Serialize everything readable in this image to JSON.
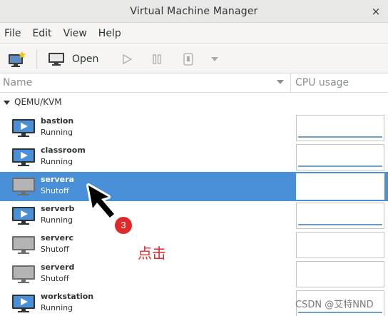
{
  "window": {
    "title": "Virtual Machine Manager",
    "close_glyph": "×"
  },
  "menu": [
    "File",
    "Edit",
    "View",
    "Help"
  ],
  "toolbar": {
    "new_vm_icon": "new-vm-icon",
    "open_label": "Open",
    "run_icon": "play-icon",
    "pause_icon": "pause-icon",
    "shutdown_icon": "shutdown-icon",
    "menu_icon": "dropdown-arrow-icon"
  },
  "columns": {
    "name": "Name",
    "cpu": "CPU usage"
  },
  "group": {
    "label": "QEMU/KVM"
  },
  "vms": [
    {
      "name": "bastion",
      "state": "Running",
      "running": true,
      "selected": false
    },
    {
      "name": "classroom",
      "state": "Running",
      "running": true,
      "selected": false
    },
    {
      "name": "servera",
      "state": "Shutoff",
      "running": false,
      "selected": true
    },
    {
      "name": "serverb",
      "state": "Running",
      "running": true,
      "selected": false
    },
    {
      "name": "serverc",
      "state": "Shutoff",
      "running": false,
      "selected": false
    },
    {
      "name": "serverd",
      "state": "Shutoff",
      "running": false,
      "selected": false
    },
    {
      "name": "workstation",
      "state": "Running",
      "running": true,
      "selected": false
    }
  ],
  "annotation": {
    "step": "3",
    "text": "点击"
  },
  "watermark": "CSDN @艾特NND",
  "colors": {
    "selection": "#4a90d9",
    "annotation_red": "#e0292b",
    "cpu_line": "#6ea0c8"
  }
}
